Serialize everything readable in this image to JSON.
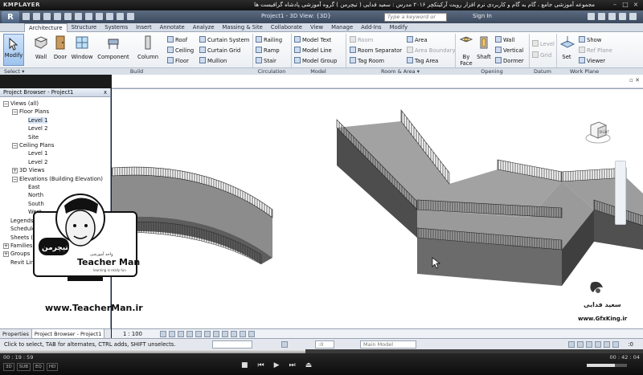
{
  "player": {
    "logo": "KMPLAYER",
    "title": "مجموعه آموزشی جامع ، گام به گام و کاربردی نرم افزار رویت آرکیتکچر ۲۰۱۶ مدرس : سعید فدایی ( تیچرمن ) گروه آموزشی پادشاه گرافیست ها",
    "time_elapsed": "00 : 19 : 59",
    "time_total": "00 : 42 : 04",
    "progress_fraction": 0.475,
    "volume_fraction": 0.7,
    "badges": [
      "3D",
      "SUB",
      "EQ",
      "HD"
    ]
  },
  "revit": {
    "app_letter": "R",
    "window_title": "Project1 - 3D View: {3D}",
    "search_placeholder": "Type a keyword or phrase",
    "sign_in": "Sign In"
  },
  "tabs": [
    "Architecture",
    "Structure",
    "Systems",
    "Insert",
    "Annotate",
    "Analyze",
    "Massing & Site",
    "Collaborate",
    "View",
    "Manage",
    "Add-Ins",
    "Modify"
  ],
  "active_tab": "Architecture",
  "ribbon": {
    "modify": "Modify",
    "select": "Select ▾",
    "build": {
      "label": "Build",
      "wall": "Wall",
      "door": "Door",
      "window": "Window",
      "component": "Component",
      "column": "Column",
      "roof": "Roof",
      "ceiling": "Ceiling",
      "floor": "Floor",
      "curtain_system": "Curtain System",
      "curtain_grid": "Curtain Grid",
      "mullion": "Mullion"
    },
    "circulation": {
      "label": "Circulation",
      "railing": "Railing",
      "ramp": "Ramp",
      "stair": "Stair"
    },
    "model": {
      "label": "Model",
      "model_text": "Model Text",
      "model_line": "Model Line",
      "model_group": "Model Group"
    },
    "room_area": {
      "label": "Room & Area ▾",
      "room": "Room",
      "room_separator": "Room Separator",
      "tag_room": "Tag Room",
      "area": "Area",
      "area_boundary": "Area Boundary",
      "tag_area": "Tag Area"
    },
    "opening": {
      "label": "Opening",
      "by_face": "By Face",
      "shaft": "Shaft",
      "wall": "Wall",
      "vertical": "Vertical",
      "dormer": "Dormer"
    },
    "datum": {
      "label": "Datum",
      "level": "Level",
      "grid": "Grid"
    },
    "work_plane": {
      "label": "Work Plane",
      "set": "Set",
      "show": "Show",
      "ref_plane": "Ref Plane",
      "viewer": "Viewer"
    }
  },
  "project_browser": {
    "title": "Project Browser - Project1",
    "close": "x",
    "nodes": [
      {
        "label": "Views (all)",
        "level": 0,
        "toggle": "−"
      },
      {
        "label": "Floor Plans",
        "level": 1,
        "toggle": "−"
      },
      {
        "label": "Level 1",
        "level": 2,
        "selected": true
      },
      {
        "label": "Level 2",
        "level": 2
      },
      {
        "label": "Site",
        "level": 2
      },
      {
        "label": "Ceiling Plans",
        "level": 1,
        "toggle": "−"
      },
      {
        "label": "Level 1",
        "level": 2
      },
      {
        "label": "Level 2",
        "level": 2
      },
      {
        "label": "3D Views",
        "level": 1,
        "toggle": "+"
      },
      {
        "label": "Elevations (Building Elevation)",
        "level": 1,
        "toggle": "−"
      },
      {
        "label": "East",
        "level": 2
      },
      {
        "label": "North",
        "level": 2
      },
      {
        "label": "South",
        "level": 2
      },
      {
        "label": "West",
        "level": 2
      },
      {
        "label": "Legends",
        "level": 0
      },
      {
        "label": "Schedules/Quantities",
        "level": 0
      },
      {
        "label": "Sheets (all)",
        "level": 0
      },
      {
        "label": "Families",
        "level": 0,
        "toggle": "+"
      },
      {
        "label": "Groups",
        "level": 0,
        "toggle": "+"
      },
      {
        "label": "Revit Links",
        "level": 0
      }
    ],
    "tab_properties": "Properties",
    "tab_browser": "Project Browser - Project1"
  },
  "viewbar": {
    "scale": "1 : 100"
  },
  "status": {
    "text": "Click to select, TAB for alternates, CTRL adds, SHIFT unselects.",
    "workset": ":0",
    "main_model": "Main Model",
    "filter_count": ":0"
  },
  "overlay": {
    "badge_brand_fa": "تیچرمن",
    "badge_subtitle_fa": "واحد آموزشی",
    "badge_name": "Teacher Man",
    "badge_tagline": "learning is really fun",
    "teacher_url": "www.TeacherMan.ir",
    "gfx_name_fa": "سعید فدایی",
    "gfx_url": "www.GfxKing.ir",
    "viewcube_face": "RIGHT"
  },
  "colors": {
    "accent": "#3c4a5e",
    "ribbon": "#e9edf2",
    "model_gray": "#6e6e6e"
  }
}
